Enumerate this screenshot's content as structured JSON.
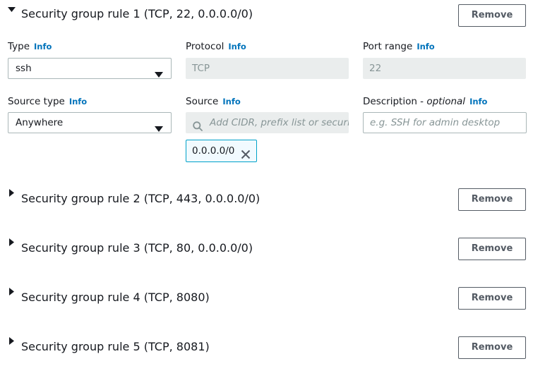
{
  "rules": [
    {
      "title": "Security group rule 1 (TCP, 22, 0.0.0.0/0)",
      "expanded": true
    },
    {
      "title": "Security group rule 2 (TCP, 443, 0.0.0.0/0)",
      "expanded": false
    },
    {
      "title": "Security group rule 3 (TCP, 80, 0.0.0.0/0)",
      "expanded": false
    },
    {
      "title": "Security group rule 4 (TCP, 8080)",
      "expanded": false
    },
    {
      "title": "Security group rule 5 (TCP, 8081)",
      "expanded": false
    }
  ],
  "remove_label": "Remove",
  "info_label": "Info",
  "rule1": {
    "type": {
      "label": "Type",
      "value": "ssh"
    },
    "protocol": {
      "label": "Protocol",
      "value": "TCP"
    },
    "port_range": {
      "label": "Port range",
      "value": "22"
    },
    "source_type": {
      "label": "Source type",
      "value": "Anywhere"
    },
    "source": {
      "label": "Source",
      "placeholder": "Add CIDR, prefix list or security",
      "token": "0.0.0.0/0"
    },
    "description": {
      "label": "Description - ",
      "label_optional": "optional",
      "placeholder": "e.g. SSH for admin desktop"
    }
  },
  "colors": {
    "link": "#0073bb",
    "token_border": "#00a1c9",
    "disabled_bg": "#eaeded"
  },
  "icons": {
    "collapsed": "caret-right-icon",
    "expanded": "caret-down-icon",
    "dropdown": "chevron-down-icon",
    "search": "search-icon",
    "close": "close-icon"
  }
}
